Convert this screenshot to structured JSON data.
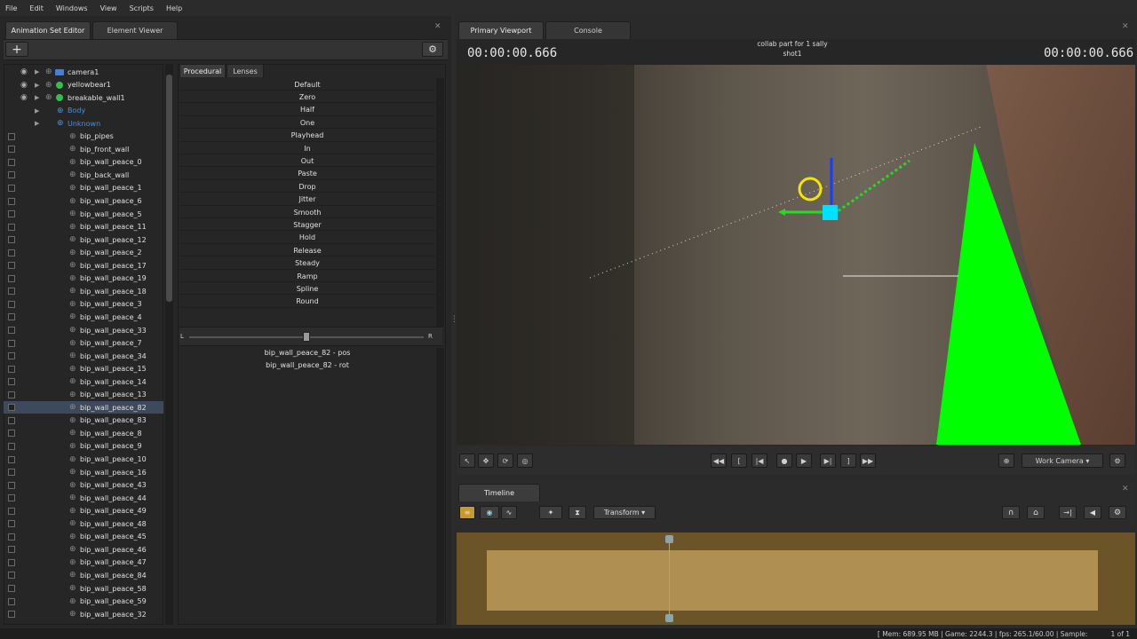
{
  "menu": [
    "File",
    "Edit",
    "Windows",
    "View",
    "Scripts",
    "Help"
  ],
  "left_tabs": {
    "animation_set_editor": "Animation Set Editor",
    "element_viewer": "Element Viewer"
  },
  "tree": [
    {
      "label": "camera1",
      "kind": "camera"
    },
    {
      "label": "yellowbear1",
      "kind": "model"
    },
    {
      "label": "breakable_wall1",
      "kind": "model"
    },
    {
      "label": "Body",
      "kind": "group"
    },
    {
      "label": "Unknown",
      "kind": "group"
    },
    {
      "label": "bip_pipes"
    },
    {
      "label": "bip_front_wall"
    },
    {
      "label": "bip_wall_peace_0"
    },
    {
      "label": "bip_back_wall"
    },
    {
      "label": "bip_wall_peace_1"
    },
    {
      "label": "bip_wall_peace_6"
    },
    {
      "label": "bip_wall_peace_5"
    },
    {
      "label": "bip_wall_peace_11"
    },
    {
      "label": "bip_wall_peace_12"
    },
    {
      "label": "bip_wall_peace_2"
    },
    {
      "label": "bip_wall_peace_17"
    },
    {
      "label": "bip_wall_peace_19"
    },
    {
      "label": "bip_wall_peace_18"
    },
    {
      "label": "bip_wall_peace_3"
    },
    {
      "label": "bip_wall_peace_4"
    },
    {
      "label": "bip_wall_peace_33"
    },
    {
      "label": "bip_wall_peace_7"
    },
    {
      "label": "bip_wall_peace_34"
    },
    {
      "label": "bip_wall_peace_15"
    },
    {
      "label": "bip_wall_peace_14"
    },
    {
      "label": "bip_wall_peace_13"
    },
    {
      "label": "bip_wall_peace_82",
      "selected": true
    },
    {
      "label": "bip_wall_peace_83"
    },
    {
      "label": "bip_wall_peace_8"
    },
    {
      "label": "bip_wall_peace_9"
    },
    {
      "label": "bip_wall_peace_10"
    },
    {
      "label": "bip_wall_peace_16"
    },
    {
      "label": "bip_wall_peace_43"
    },
    {
      "label": "bip_wall_peace_44"
    },
    {
      "label": "bip_wall_peace_49"
    },
    {
      "label": "bip_wall_peace_48"
    },
    {
      "label": "bip_wall_peace_45"
    },
    {
      "label": "bip_wall_peace_46"
    },
    {
      "label": "bip_wall_peace_47"
    },
    {
      "label": "bip_wall_peace_84"
    },
    {
      "label": "bip_wall_peace_58"
    },
    {
      "label": "bip_wall_peace_59"
    },
    {
      "label": "bip_wall_peace_32"
    }
  ],
  "procedural": {
    "tabs": [
      "Procedural",
      "Lenses"
    ],
    "buttons": [
      "Default",
      "Zero",
      "Half",
      "One",
      "Playhead",
      "In",
      "Out",
      "Paste",
      "Drop",
      "Jitter",
      "Smooth",
      "Stagger",
      "Hold",
      "Release",
      "Steady",
      "Ramp",
      "Spline",
      "Round"
    ],
    "slider_left": "L",
    "slider_right": "R",
    "slider_value": 0.5,
    "channels": [
      "bip_wall_peace_82 - pos",
      "bip_wall_peace_82 - rot"
    ]
  },
  "viewport": {
    "tabs": [
      "Primary Viewport",
      "Console"
    ],
    "time_left": "00:00:00.666",
    "time_right": "00:00:00.666",
    "title_line1": "collab part for 1 sally",
    "title_line2": "shot1",
    "camera": "Work Camera"
  },
  "timeline": {
    "tab": "Timeline",
    "mode": "Transform"
  },
  "status": {
    "text": "[ Mem:   689.95 MB | Game:    2244.3 | fps:  265.1/60.00 | Sample:",
    "page": "1 of 1"
  },
  "colors": {
    "accent_green": "#00ff00",
    "timeline": "#af8f52",
    "timeline_dark": "#6b5428",
    "selection": "#3c4a5c",
    "link_blue": "#4a8fe0"
  }
}
